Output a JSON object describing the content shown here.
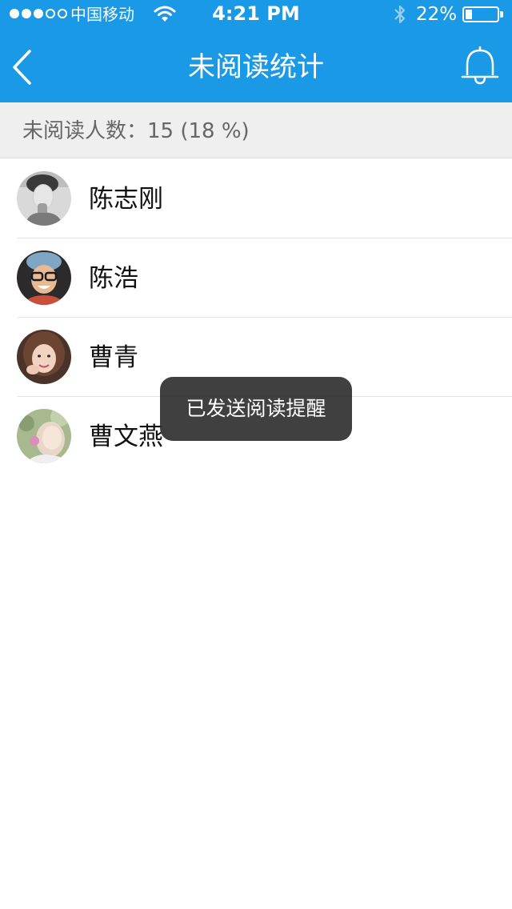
{
  "status_bar": {
    "carrier": "中国移动",
    "time": "4:21 PM",
    "battery_percent": "22%",
    "battery_level": 0.22,
    "signal_bars": 3,
    "signal_total": 5
  },
  "header": {
    "title": "未阅读统计",
    "back_icon": "chevron-left-icon",
    "right_icon": "bell-icon",
    "color": "#1a9ae6"
  },
  "summary": {
    "text": "未阅读人数：15 (18 %)"
  },
  "members": [
    {
      "name": "陈志刚"
    },
    {
      "name": "陈浩"
    },
    {
      "name": "曹青"
    },
    {
      "name": "曹文燕"
    }
  ],
  "toast": {
    "message": "已发送阅读提醒"
  }
}
